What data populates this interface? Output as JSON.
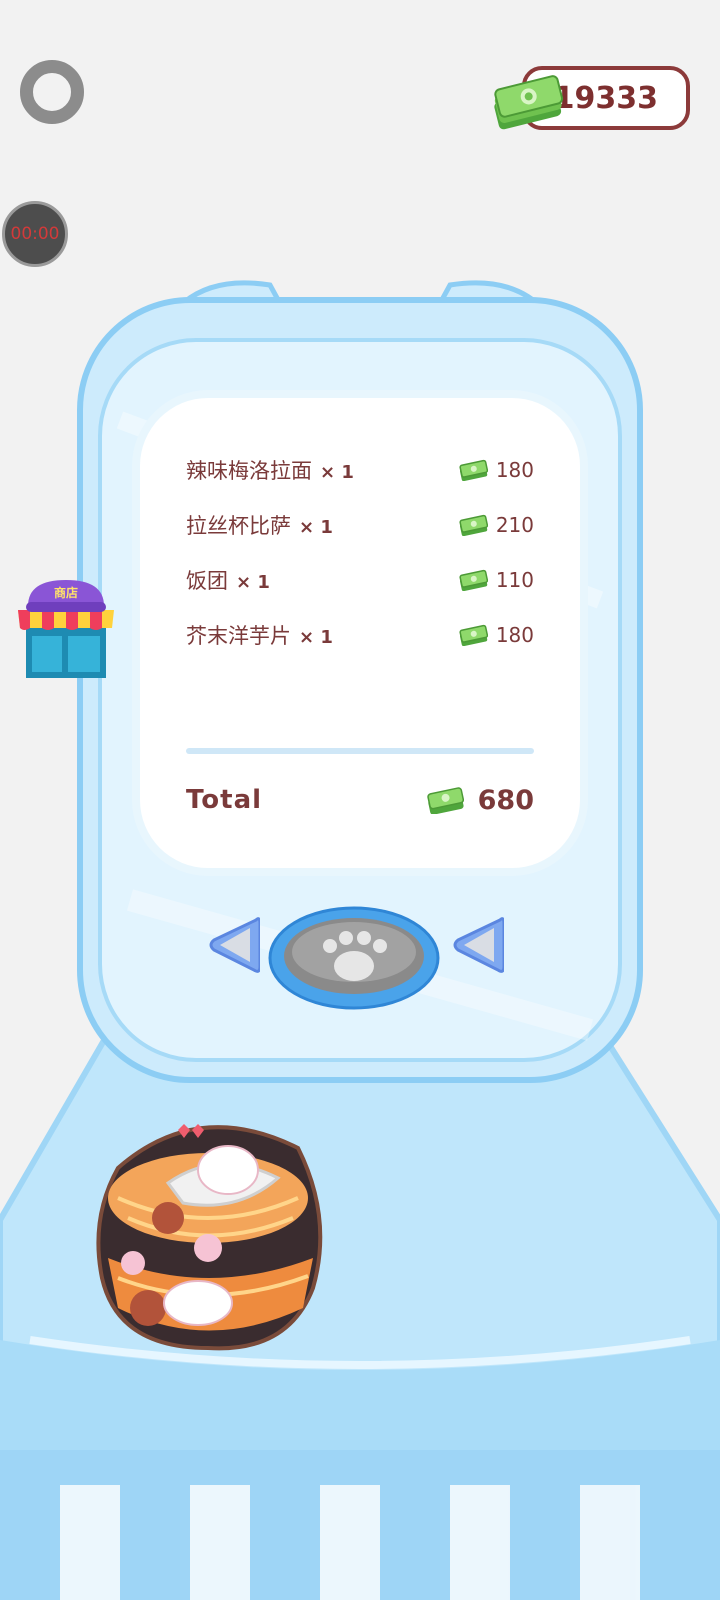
{
  "hud": {
    "timer": "00:00",
    "money": "19333"
  },
  "shop": {
    "label": "商店"
  },
  "receipt": {
    "items": [
      {
        "name": "辣味梅洛拉面",
        "qty": "× 1",
        "price": "180"
      },
      {
        "name": "拉丝杯比萨",
        "qty": "× 1",
        "price": "210"
      },
      {
        "name": "饭团",
        "qty": "× 1",
        "price": "110"
      },
      {
        "name": "芥末洋芋片",
        "qty": "× 1",
        "price": "180"
      }
    ],
    "total_label": "Total",
    "total": "680"
  },
  "icons": {
    "settings": "ring-icon",
    "money": "cash-stack-icon",
    "shop": "storefront-icon",
    "prev": "left-arrow-icon",
    "next": "left-arrow-icon",
    "confirm": "paw-icon",
    "food": "ramen-bowl-icon"
  },
  "colors": {
    "background": "#f2f2f2",
    "machine_blue": "#bfe4fb",
    "machine_edge": "#8ccdf4",
    "text_brown": "#7a3a3a",
    "cash_green": "#7cc95a"
  }
}
